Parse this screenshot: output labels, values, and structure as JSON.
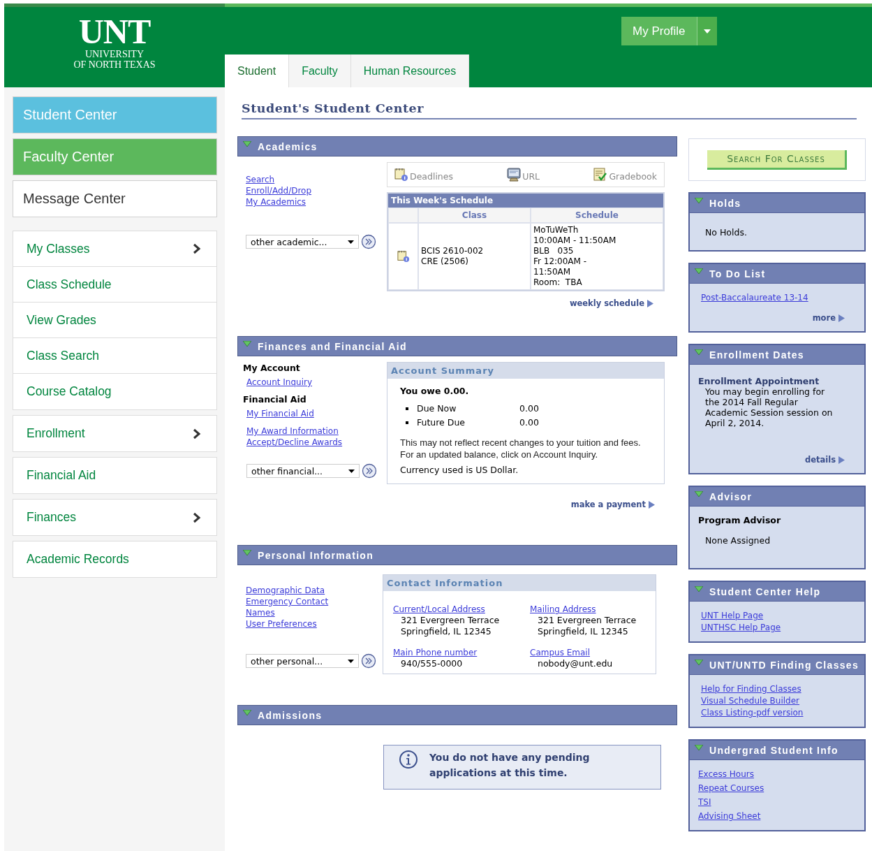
{
  "header": {
    "logo": {
      "wordmark": "UNT",
      "line1": "UNIVERSITY",
      "line2": "OF NORTH TEXAS"
    },
    "profile_button": "My Profile",
    "tabs": [
      {
        "label": "Student",
        "selected": true
      },
      {
        "label": "Faculty",
        "selected": false
      },
      {
        "label": "Human Resources",
        "selected": false
      }
    ]
  },
  "sidebar": {
    "centers": [
      {
        "label": "Student Center",
        "color": "#5bc0de"
      },
      {
        "label": "Faculty Center",
        "color": "#5cb85c"
      },
      {
        "label": "Message Center",
        "color": "#ffffff"
      }
    ],
    "menu_groups": [
      {
        "items": [
          {
            "label": "My Classes",
            "has_submenu": true
          },
          {
            "label": "Class Schedule",
            "has_submenu": false
          },
          {
            "label": "View Grades",
            "has_submenu": false
          },
          {
            "label": "Class Search",
            "has_submenu": false
          },
          {
            "label": "Course Catalog",
            "has_submenu": false
          }
        ]
      },
      {
        "items": [
          {
            "label": "Enrollment",
            "has_submenu": true
          }
        ]
      },
      {
        "items": [
          {
            "label": "Financial Aid",
            "has_submenu": false
          }
        ]
      },
      {
        "items": [
          {
            "label": "Finances",
            "has_submenu": true
          }
        ]
      },
      {
        "items": [
          {
            "label": "Academic Records",
            "has_submenu": false
          }
        ]
      }
    ]
  },
  "page_title": "Student's Student Center",
  "academics": {
    "title": "Academics",
    "expanded": true,
    "links": [
      "Search",
      "Enroll/Add/Drop",
      "My Academics"
    ],
    "dropdown": "other academic...",
    "tools": [
      {
        "label": "Deadlines",
        "kind": "calendar"
      },
      {
        "label": "URL",
        "kind": "monitor"
      },
      {
        "label": "Gradebook",
        "kind": "checklist"
      }
    ],
    "schedule": {
      "title": "This Week's Schedule",
      "columns": [
        "Class",
        "Schedule"
      ],
      "rows": [
        {
          "class_lines": [
            "BCIS 2610-002",
            "CRE (2506)"
          ],
          "schedule_lines": [
            "MoTuWeTh",
            "10:00AM - 11:50AM",
            "BLB   035",
            "Fr 12:00AM -",
            "11:50AM",
            "Room:  TBA"
          ]
        }
      ]
    },
    "more_link": "weekly schedule"
  },
  "finances": {
    "title": "Finances and Financial Aid",
    "expanded": true,
    "blocks": [
      {
        "heading": "My Account",
        "links": [
          "Account Inquiry"
        ]
      },
      {
        "heading": "Financial Aid",
        "links": [
          "My Financial Aid"
        ]
      },
      {
        "links": [
          "My Award Information",
          "Accept/Decline Awards"
        ]
      }
    ],
    "dropdown": "other financial...",
    "summary": {
      "title": "Account Summary",
      "owe": "You owe 0.00.",
      "items": [
        {
          "label": "Due Now",
          "amount": "0.00"
        },
        {
          "label": "Future Due",
          "amount": "0.00"
        }
      ],
      "note": "This may not reflect recent changes to your tuition and fees. For an updated balance, click on Account Inquiry.",
      "currency": "Currency used is US Dollar."
    },
    "more_link": "make a payment"
  },
  "personal": {
    "title": "Personal Information",
    "expanded": true,
    "links": [
      "Demographic Data",
      "Emergency Contact",
      "Names",
      "User Preferences"
    ],
    "dropdown": "other personal...",
    "contact": {
      "title": "Contact Information",
      "fields": [
        {
          "label": "Current/Local Address",
          "lines": [
            "321 Evergreen Terrace",
            "Springfield, IL 12345"
          ]
        },
        {
          "label": "Mailing Address",
          "lines": [
            "321 Evergreen Terrace",
            "Springfield, IL 12345"
          ]
        },
        {
          "label": "Main Phone number",
          "lines": [
            "940/555-0000"
          ]
        },
        {
          "label": "Campus Email",
          "lines": [
            "nobody@unt.edu"
          ]
        }
      ]
    }
  },
  "admissions": {
    "title": "Admissions",
    "expanded": true,
    "message": "You do not have any pending applications at this time."
  },
  "right": {
    "search_button": "Search For Classes",
    "boxes": [
      {
        "title": "Holds",
        "expanded": true,
        "text": "No Holds."
      },
      {
        "title": "To Do List",
        "expanded": true,
        "links": [
          "Post-Baccalaureate 13-14"
        ],
        "more_link": "more"
      },
      {
        "title": "Enrollment Dates",
        "expanded": true,
        "heading": "Enrollment Appointment",
        "text": "You may begin enrolling for the 2014 Fall Regular Academic Session session on April 2, 2014.",
        "more_link": "details"
      },
      {
        "title": "Advisor",
        "expanded": true,
        "heading": "Program Advisor",
        "text": "None Assigned"
      },
      {
        "title": "Student Center Help",
        "expanded": true,
        "links": [
          "UNT Help Page",
          "UNTHSC Help Page"
        ]
      },
      {
        "title": "UNT/UNTD Finding Classes",
        "expanded": true,
        "links": [
          "Help for Finding Classes",
          "Visual Schedule Builder",
          "Class Listing-pdf version"
        ]
      },
      {
        "title": "Undergrad Student Info",
        "expanded": true,
        "links": [
          "Excess Hours",
          "Repeat Courses",
          "TSI",
          "Advising Sheet"
        ]
      }
    ]
  }
}
